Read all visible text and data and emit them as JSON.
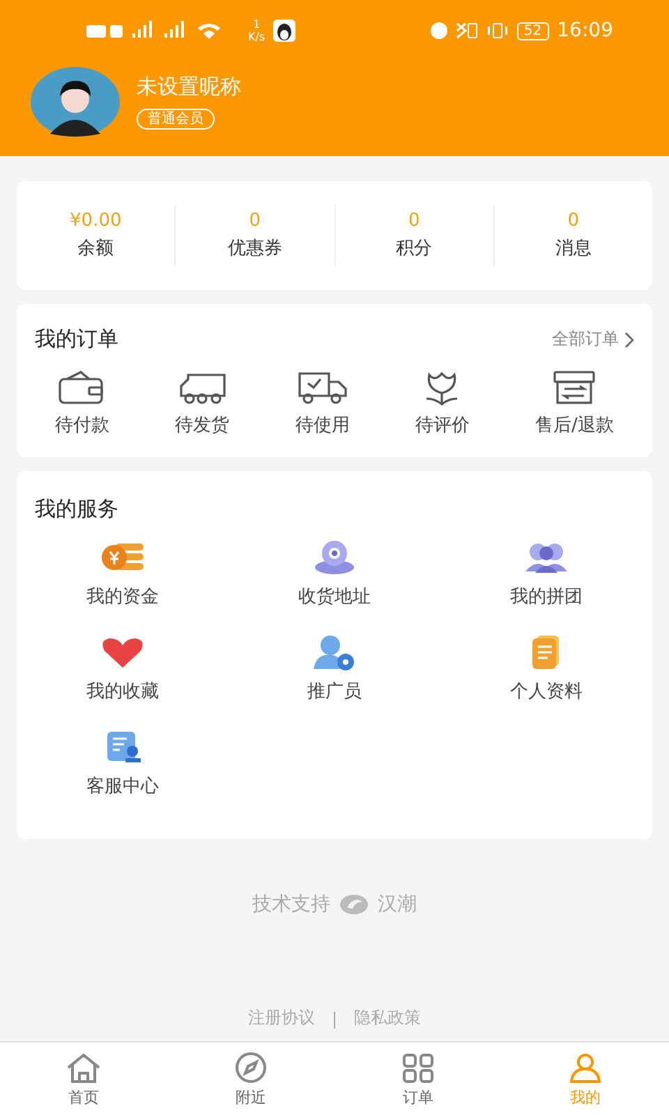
{
  "status_bar": {
    "network_speed": "1",
    "speed_unit": "K/s",
    "battery": "52",
    "time": "16:09"
  },
  "profile": {
    "nickname": "未设置昵称",
    "member_badge": "普通会员"
  },
  "stats": [
    {
      "value": "¥0.00",
      "label": "余额"
    },
    {
      "value": "0",
      "label": "优惠券"
    },
    {
      "value": "0",
      "label": "积分"
    },
    {
      "value": "0",
      "label": "消息"
    }
  ],
  "orders": {
    "title": "我的订单",
    "all_link": "全部订单",
    "items": [
      "待付款",
      "待发货",
      "待使用",
      "待评价",
      "售后/退款"
    ]
  },
  "services": {
    "title": "我的服务",
    "items": [
      "我的资金",
      "收货地址",
      "我的拼团",
      "我的收藏",
      "推广员",
      "个人资料",
      "客服中心"
    ]
  },
  "footer": {
    "support_label": "技术支持",
    "brand": "汉潮",
    "links": [
      "注册协议",
      "隐私政策"
    ],
    "separator": "|"
  },
  "tab_bar": [
    {
      "label": "首页",
      "selected": false
    },
    {
      "label": "附近",
      "selected": false
    },
    {
      "label": "订单",
      "selected": false
    },
    {
      "label": "我的",
      "selected": true
    }
  ]
}
